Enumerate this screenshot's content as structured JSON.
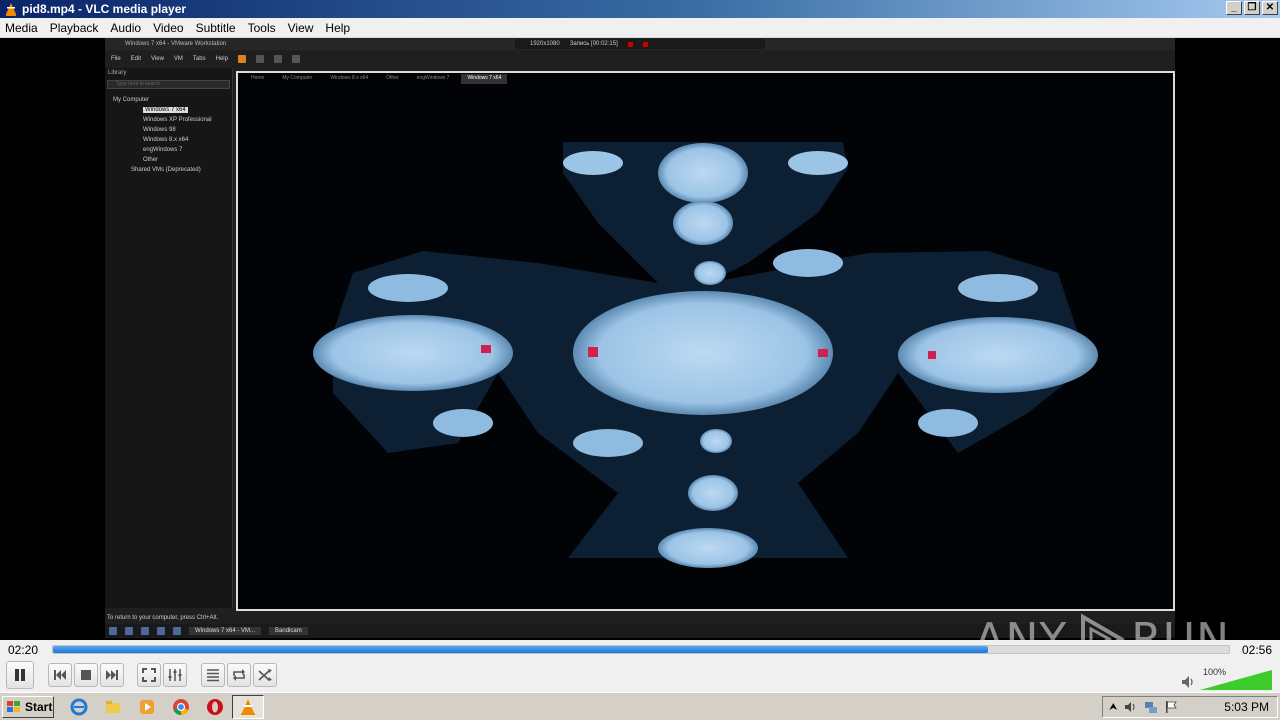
{
  "window": {
    "title": "pid8.mp4 - VLC media player",
    "buttons": [
      "minimize",
      "restore",
      "close"
    ]
  },
  "menu": [
    "Media",
    "Playback",
    "Audio",
    "Video",
    "Subtitle",
    "Tools",
    "View",
    "Help"
  ],
  "video": {
    "vmware": {
      "title": "Windows 7 x64 - VMware Workstation",
      "recorder": {
        "resolution": "1920x1080",
        "label": "Запись [00:02:15]"
      },
      "menu": [
        "File",
        "Edit",
        "View",
        "VM",
        "Tabs",
        "Help"
      ],
      "library": {
        "header": "Library",
        "search_placeholder": "Type here to search",
        "root": "My Computer",
        "items": [
          "Windows 7 x64",
          "Windows XP Professional",
          "Windows 98",
          "Windows 8.x x64",
          "engWindows 7",
          "Other"
        ],
        "shared": "Shared VMs (Deprecated)"
      },
      "tabs": [
        "Home",
        "My Computer",
        "Windows 8.x x64",
        "Other",
        "engWindows 7",
        "Windows 7 x64"
      ],
      "hint": "To return to your computer, press Ctrl+Alt.",
      "taskbar": {
        "task1": "Windows 7 x64 - VM...",
        "task2": "Bandicam"
      }
    },
    "watermark": {
      "left": "ANY",
      "right": "RUN"
    }
  },
  "playback": {
    "current_time": "02:20",
    "total_time": "02:56",
    "progress_fraction": 0.795
  },
  "controls": {
    "icons": [
      "pause-icon",
      "previous-icon",
      "stop-icon",
      "next-icon",
      "fullscreen-icon",
      "extended-settings-icon",
      "playlist-icon",
      "loop-icon",
      "shuffle-icon"
    ],
    "volume_label": "100%",
    "volume_fraction": 1.0
  },
  "taskbar": {
    "start_label": "Start",
    "clock": "5:03 PM",
    "quick_launch": [
      "internet-explorer-icon",
      "folder-icon",
      "media-player-icon",
      "chrome-icon",
      "opera-icon",
      "vlc-icon"
    ]
  }
}
